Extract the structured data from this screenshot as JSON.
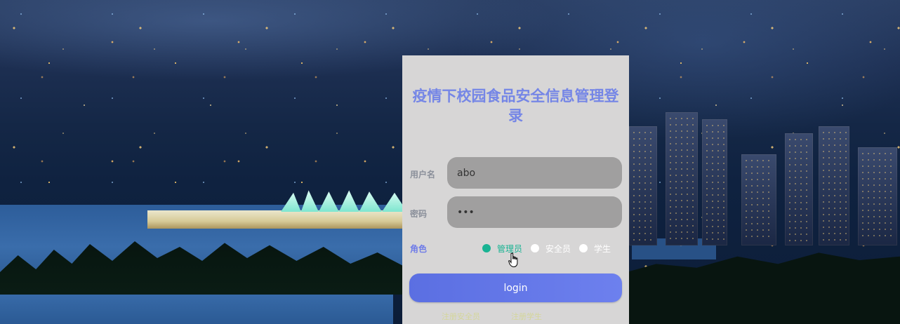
{
  "login": {
    "title": "疫情下校园食品安全信息管理登录",
    "username_label": "用户名",
    "username_value": "abo",
    "password_label": "密码",
    "password_value": "•••",
    "role_label": "角色",
    "roles": [
      {
        "label": "管理员",
        "checked": true
      },
      {
        "label": "安全员",
        "checked": false
      },
      {
        "label": "学生",
        "checked": false
      }
    ],
    "login_button": "login",
    "register_links": [
      "注册安全员",
      "注册学生"
    ]
  },
  "colors": {
    "title": "#7586e6",
    "accent_green": "#19b393",
    "button": "#5b6fe2",
    "card_bg": "#d7d6d6",
    "input_bg": "#a09f9f"
  }
}
